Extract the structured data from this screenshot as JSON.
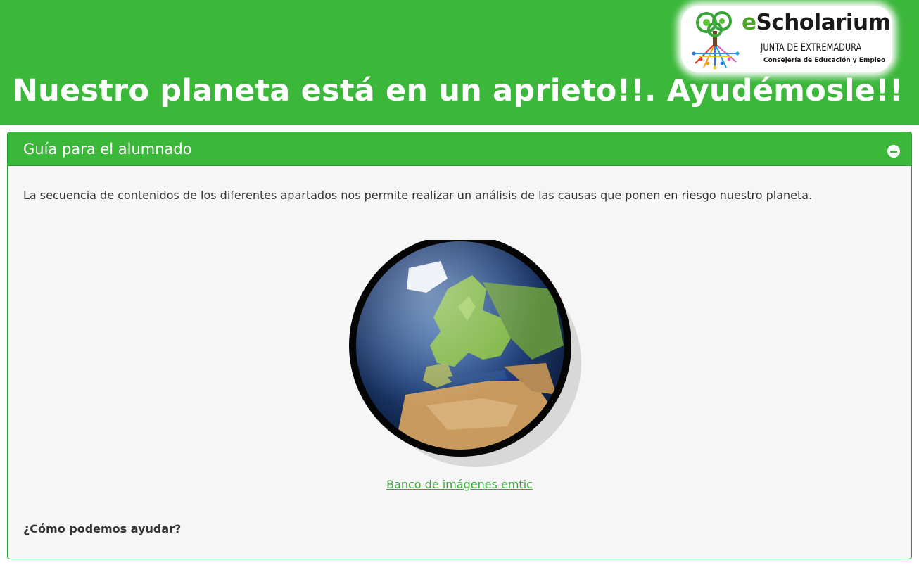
{
  "header": {
    "title": "Nuestro planeta está en un aprieto!!. Ayudémosle!!",
    "background_color": "#3bb73a"
  },
  "logo": {
    "brand_prefix": "e",
    "brand_main": "Scholarium",
    "line1": "JUNTA DE EXTREMADURA",
    "line2": "Consejería de Educación y Empleo"
  },
  "panel": {
    "title": "Guía para el alumnado",
    "collapse_icon": "minus-circle-icon",
    "intro_text": "La secuencia de contenidos de los diferentes apartados nos permite realizar un análisis de las causas que ponen en riesgo nuestro planeta.",
    "image_icon": "earth-globe-icon",
    "image_credit": "Banco de imágenes emtic",
    "question": "¿Cómo podemos ayudar?",
    "accent_color": "#3bb73a",
    "link_color": "#3aa63a"
  }
}
